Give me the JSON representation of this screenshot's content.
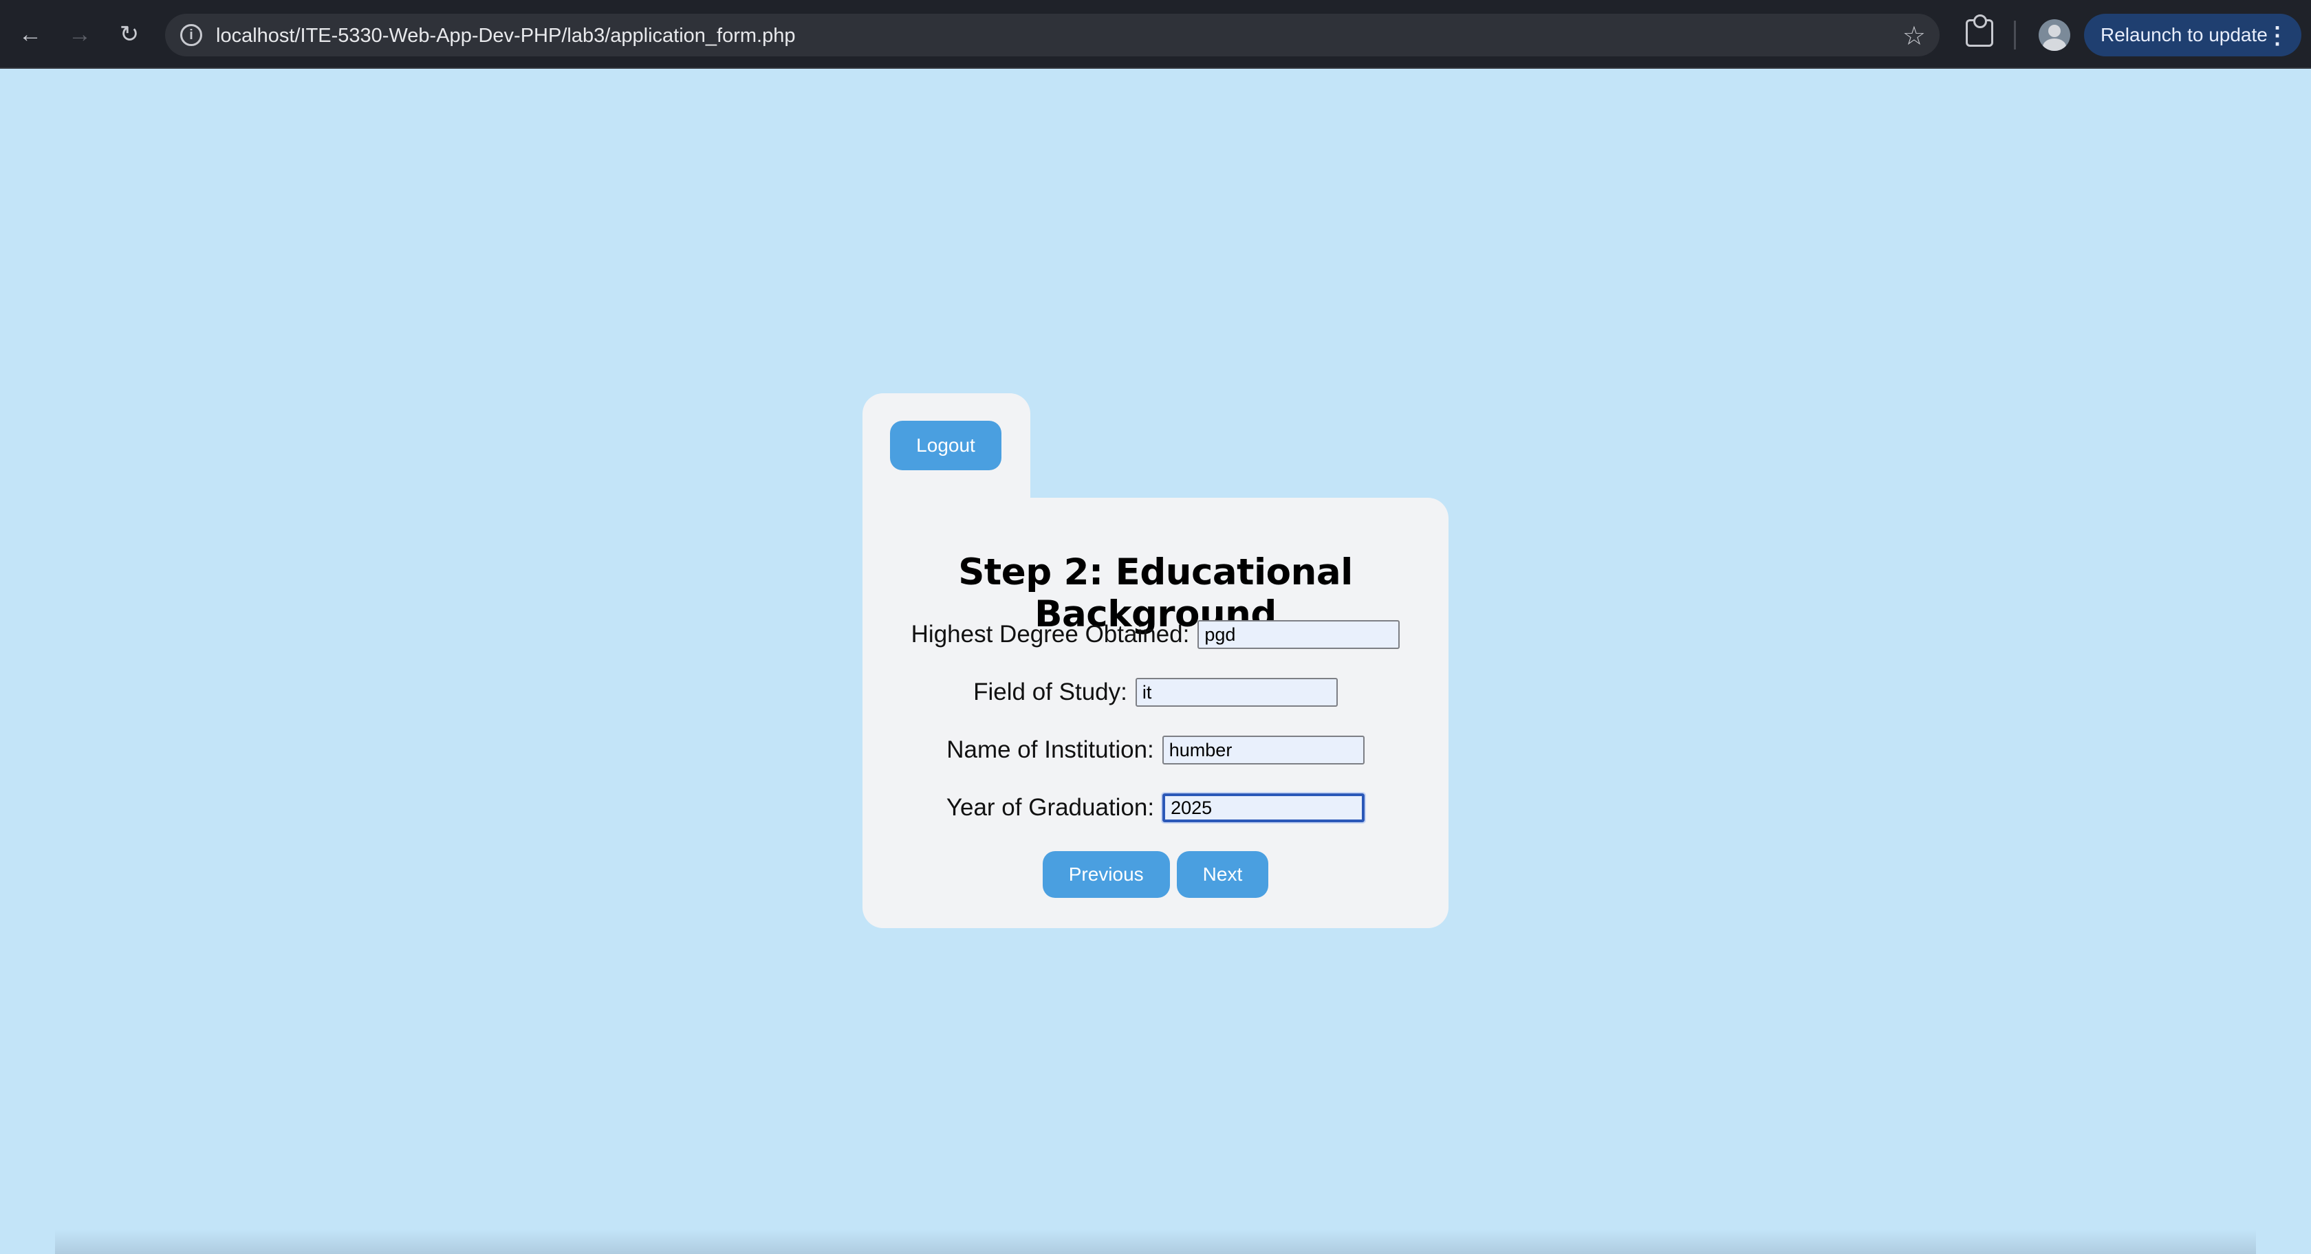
{
  "browser": {
    "url": "localhost/ITE-5330-Web-App-Dev-PHP/lab3/application_form.php",
    "relaunch_label": "Relaunch to update",
    "icons": {
      "back": "back-arrow-icon",
      "forward": "forward-arrow-icon",
      "reload": "reload-icon",
      "site_info": "info-icon",
      "bookmark": "star-icon",
      "extensions": "extensions-icon",
      "profile": "avatar",
      "menu": "kebab-menu-icon"
    }
  },
  "page": {
    "logout_label": "Logout",
    "title": "Step 2: Educational Background",
    "fields": [
      {
        "label": "Highest Degree Obtained:",
        "value": "pgd"
      },
      {
        "label": "Field of Study:",
        "value": "it"
      },
      {
        "label": "Name of Institution:",
        "value": "humber"
      },
      {
        "label": "Year of Graduation:",
        "value": "2025"
      }
    ],
    "previous_label": "Previous",
    "next_label": "Next"
  },
  "colors": {
    "background": "#c3e4f8",
    "card": "#f2f3f5",
    "button": "#4a9fe0",
    "chrome": "#1f2229"
  }
}
